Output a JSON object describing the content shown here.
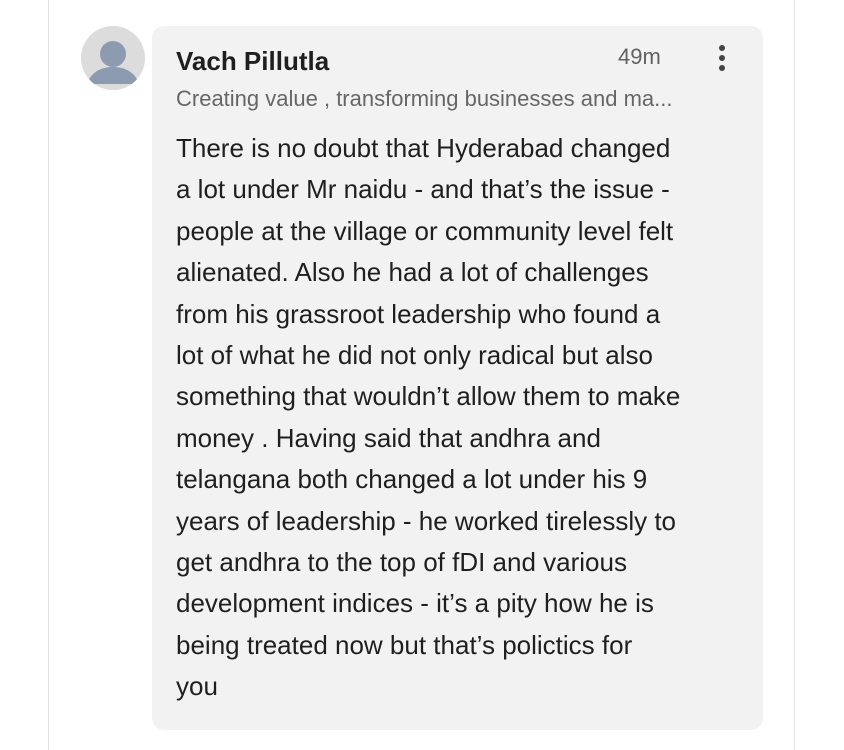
{
  "comment": {
    "author": "Vach Pillutla",
    "headline": "Creating value , transforming businesses and ma...",
    "timestamp": "49m",
    "more_icon": "vertical-ellipsis-icon",
    "avatar_icon": "default-person-avatar",
    "body_lines": [
      "There is no doubt that Hyderabad changed",
      "a lot under Mr naidu - and that’s the issue -",
      "people at the village or community level felt",
      "alienated. Also he had a lot of challenges",
      "from his grassroot leadership who found a",
      "lot of what he did not only radical but also",
      "something that wouldn’t allow them to make",
      "money . Having said that andhra and",
      "telangana both changed a lot under his 9",
      "years of leadership - he worked tirelessly to",
      "get andhra to the top of  fDI and various",
      "development indices - it’s a pity how he is",
      "being treated now but that’s polictics for",
      "you"
    ]
  },
  "colors": {
    "bubble_background": "#f2f2f2",
    "text_primary": "#1f1f1f",
    "text_secondary": "#666666",
    "avatar_background": "#dcdcdc",
    "avatar_figure": "#8d9bb0"
  }
}
